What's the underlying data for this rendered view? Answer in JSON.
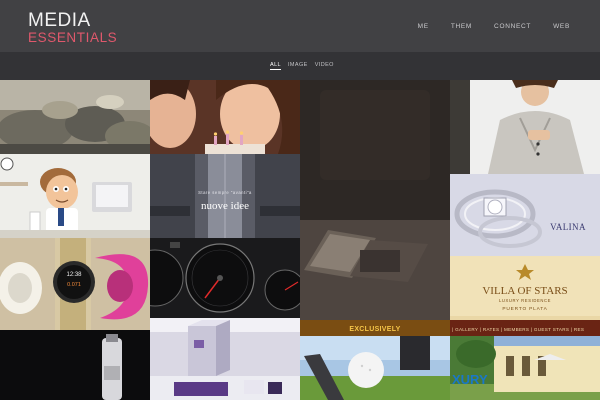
{
  "brand": {
    "line1": "MEDIA",
    "line2": "ESSENTIALS"
  },
  "nav": {
    "items": [
      "ME",
      "THEM",
      "CONNECT",
      "WEB"
    ]
  },
  "filters": {
    "items": [
      "ALL",
      "IMAGE",
      "VIDEO"
    ],
    "active": "ALL"
  },
  "tiles": {
    "idee_line1": "Stare sempre \"avanti\"a",
    "idee_line2": "nuove idee",
    "watch_time": "12:38",
    "watch_value": "0.071",
    "valina": "VALINA",
    "villa_title": "VILLA OF STARS",
    "villa_sub": "LUXURY RESIDENCE",
    "villa_place": "PUERTO PLATA",
    "villa_menu": "| GALLERY | RATES | MEMBERS | GUEST STARS | RES",
    "exclusively": "EXCLUSIVELY",
    "xury": "XURY"
  },
  "colors": {
    "header_bg": "#414144",
    "filter_bg": "#333336",
    "brand_accent": "#e0586c"
  }
}
